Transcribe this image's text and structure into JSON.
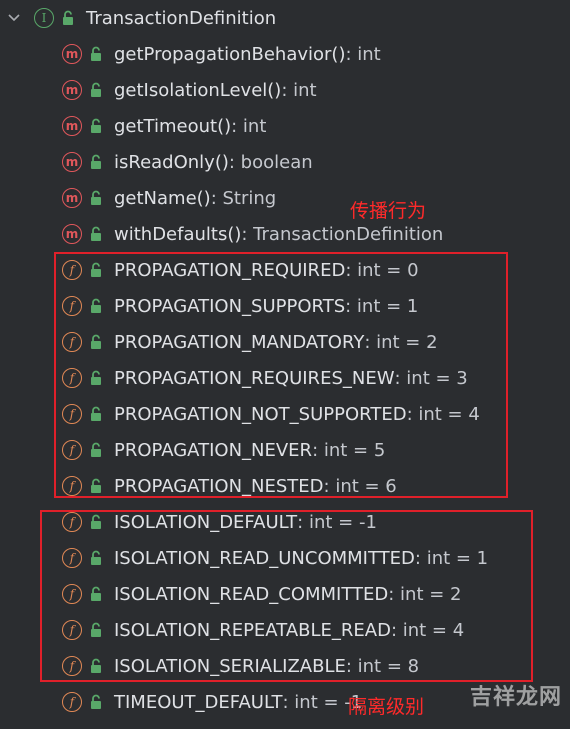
{
  "root": {
    "label": "TransactionDefinition",
    "kind_letter": "I"
  },
  "methods": [
    {
      "name": "getPropagationBehavior()",
      "type": ": int"
    },
    {
      "name": "getIsolationLevel()",
      "type": ": int"
    },
    {
      "name": "getTimeout()",
      "type": ": int"
    },
    {
      "name": "isReadOnly()",
      "type": ": boolean"
    },
    {
      "name": "getName()",
      "type": ": String"
    },
    {
      "name": "withDefaults()",
      "type": ": TransactionDefinition"
    }
  ],
  "propagation_fields": [
    {
      "name": "PROPAGATION_REQUIRED",
      "type": ": int = 0"
    },
    {
      "name": "PROPAGATION_SUPPORTS",
      "type": ": int = 1"
    },
    {
      "name": "PROPAGATION_MANDATORY",
      "type": ": int = 2"
    },
    {
      "name": "PROPAGATION_REQUIRES_NEW",
      "type": ": int = 3"
    },
    {
      "name": "PROPAGATION_NOT_SUPPORTED",
      "type": ": int = 4"
    },
    {
      "name": "PROPAGATION_NEVER",
      "type": ": int = 5"
    },
    {
      "name": "PROPAGATION_NESTED",
      "type": ": int = 6"
    }
  ],
  "isolation_fields": [
    {
      "name": "ISOLATION_DEFAULT",
      "type": ": int = -1"
    },
    {
      "name": "ISOLATION_READ_UNCOMMITTED",
      "type": ": int = 1"
    },
    {
      "name": "ISOLATION_READ_COMMITTED",
      "type": ": int = 2"
    },
    {
      "name": "ISOLATION_REPEATABLE_READ",
      "type": ": int = 4"
    },
    {
      "name": "ISOLATION_SERIALIZABLE",
      "type": ": int = 8"
    }
  ],
  "timeout_field": {
    "name": "TIMEOUT_DEFAULT",
    "type": ": int = -1"
  },
  "annotations": {
    "propagation": "传播行为",
    "isolation": "隔离级别"
  },
  "watermark": "吉祥龙网",
  "icons": {
    "method": "m",
    "field": "f",
    "lock": "unlock-icon"
  },
  "colors": {
    "background": "#2b2d30",
    "method_icon": "#e0575b",
    "field_icon": "#e08855",
    "interface_icon": "#59a869",
    "annotation": "#ff2a2a"
  }
}
